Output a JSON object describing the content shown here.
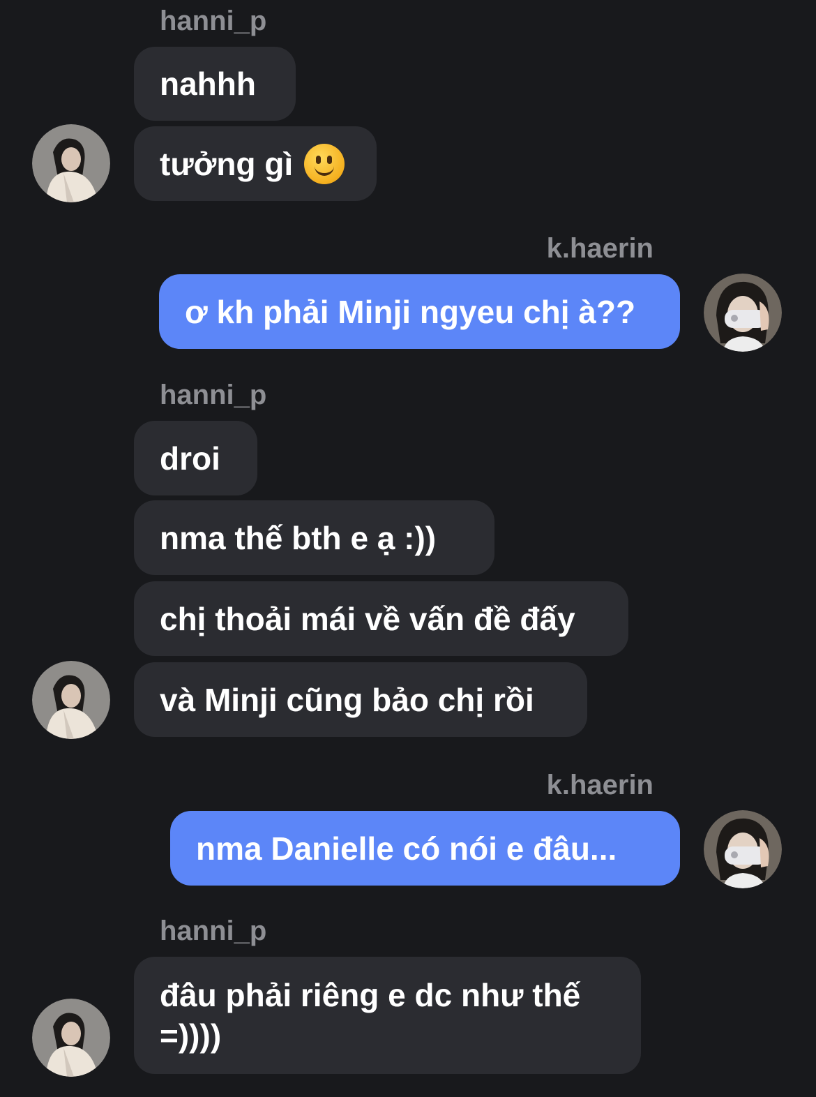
{
  "messages": [
    {
      "sender": "hanni_p",
      "bubbles": [
        "nahhh",
        "tưởng gì",
        "🙂"
      ]
    },
    {
      "sender": "k.haerin",
      "bubbles": [
        "ơ kh phải Minji ngyeu chị à??"
      ]
    },
    {
      "sender": "hanni_p",
      "bubbles": [
        "droi",
        "nma thế bth e ạ :))",
        "chị thoải mái về vấn đề đấy",
        "và Minji cũng bảo chị rồi"
      ]
    },
    {
      "sender": "k.haerin",
      "bubbles": [
        "nma Danielle có nói e đâu..."
      ]
    },
    {
      "sender": "hanni_p",
      "bubbles": [
        "đâu phải riêng e dc như thế =))))"
      ]
    }
  ],
  "icons": {
    "emoji": "slightly-smiling-face-icon",
    "avatar_hanni": "avatar-hanni",
    "avatar_haerin": "avatar-haerin"
  },
  "colors": {
    "background": "#18191c",
    "incoming_bubble": "#2b2c31",
    "outgoing_bubble": "#5c86f8",
    "sender_label": "#8e8f94"
  }
}
